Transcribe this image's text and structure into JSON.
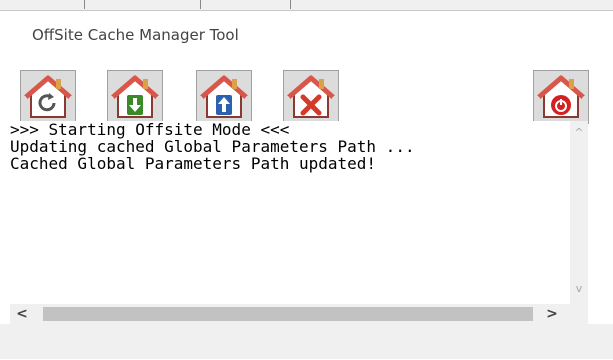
{
  "window": {
    "title": "OffSite Cache Manager Tool"
  },
  "toolbar": {
    "buttons": [
      {
        "name": "refresh-button",
        "icon": "house-refresh-icon"
      },
      {
        "name": "download-button",
        "icon": "house-download-icon"
      },
      {
        "name": "upload-button",
        "icon": "house-upload-icon"
      },
      {
        "name": "delete-button",
        "icon": "house-delete-icon"
      },
      {
        "name": "power-button",
        "icon": "house-power-icon"
      }
    ]
  },
  "console": {
    "lines": [
      ">>> Starting Offsite Mode <<<",
      "Updating cached Global Parameters Path ...",
      "Cached Global Parameters Path updated!"
    ]
  },
  "scrollbars": {
    "up_arrow": "^",
    "down_arrow": "v",
    "left_arrow": "<",
    "right_arrow": ">"
  },
  "colors": {
    "house_roof": "#d9574a",
    "house_body": "#ffffff",
    "refresh": "#555555",
    "download": "#3a8a2a",
    "upload": "#2a62b0",
    "delete": "#d23a2a",
    "power": "#d32020"
  }
}
